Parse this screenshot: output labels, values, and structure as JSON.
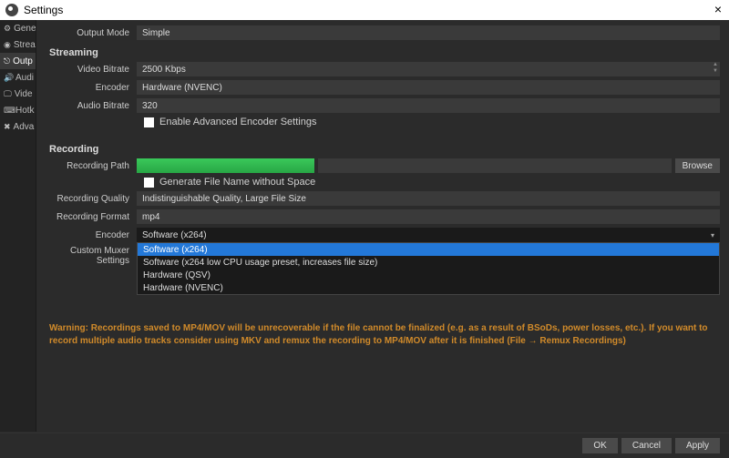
{
  "window": {
    "title": "Settings"
  },
  "sidebar": {
    "items": [
      {
        "icon": "⚙",
        "label": "Gene"
      },
      {
        "icon": "◉",
        "label": "Strea"
      },
      {
        "icon": "⎋",
        "label": "Outp"
      },
      {
        "icon": "🔊",
        "label": "Audi"
      },
      {
        "icon": "🖵",
        "label": "Vide"
      },
      {
        "icon": "⌨",
        "label": "Hotk"
      },
      {
        "icon": "✖",
        "label": "Adva"
      }
    ]
  },
  "output_mode": {
    "label": "Output Mode",
    "value": "Simple"
  },
  "streaming": {
    "title": "Streaming",
    "video_bitrate": {
      "label": "Video Bitrate",
      "value": "2500 Kbps"
    },
    "encoder": {
      "label": "Encoder",
      "value": "Hardware (NVENC)"
    },
    "audio_bitrate": {
      "label": "Audio Bitrate",
      "value": "320"
    },
    "adv_checkbox": "Enable Advanced Encoder Settings"
  },
  "recording": {
    "title": "Recording",
    "path": {
      "label": "Recording Path",
      "browse": "Browse"
    },
    "gen_checkbox": "Generate File Name without Space",
    "quality": {
      "label": "Recording Quality",
      "value": "Indistinguishable Quality, Large File Size"
    },
    "format": {
      "label": "Recording Format",
      "value": "mp4"
    },
    "encoder": {
      "label": "Encoder",
      "value": "Software (x264)"
    },
    "muxer": {
      "label": "Custom Muxer Settings"
    },
    "encoder_options": [
      "Software (x264)",
      "Software (x264 low CPU usage preset, increases file size)",
      "Hardware (QSV)",
      "Hardware (NVENC)"
    ]
  },
  "warning": "Warning: Recordings saved to MP4/MOV will be unrecoverable if the file cannot be finalized (e.g. as a result of BSoDs, power losses, etc.). If you want to record multiple audio tracks consider using MKV and remux the recording to MP4/MOV after it is finished (File → Remux Recordings)",
  "footer": {
    "ok": "OK",
    "cancel": "Cancel",
    "apply": "Apply"
  }
}
